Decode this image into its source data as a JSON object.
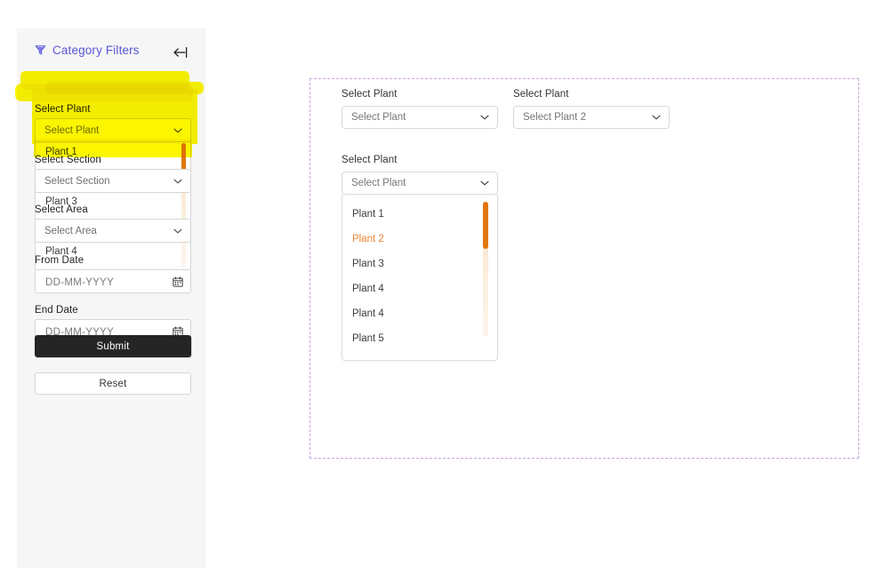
{
  "sidebar": {
    "title": "Category Filters",
    "filter_icon": "funnel-icon",
    "collapse_icon": "collapse-left-arrow-icon",
    "fields": [
      {
        "label": "Select Plant",
        "placeholder": "Select Plant",
        "type": "select"
      },
      {
        "label": "Select Section",
        "placeholder": "Select Section",
        "type": "select"
      },
      {
        "label": "Select Area",
        "placeholder": "Select Area",
        "type": "select"
      },
      {
        "label": "From Date",
        "placeholder": "DD-MM-YYYY",
        "value": "",
        "type": "date"
      },
      {
        "label": "End Date",
        "placeholder": "DD-MM-YYYY",
        "value": "",
        "type": "date"
      }
    ],
    "open_list_options": [
      "Plant 1",
      "Plant 3",
      "Plant 4"
    ],
    "buttons": {
      "submit": "Submit",
      "reset": "Reset"
    },
    "annotation": {
      "type": "yellow-marker-highlight",
      "color": "#fbf500",
      "target": "Select Plant field"
    }
  },
  "main": {
    "border_color": "#c9a6d3",
    "groups": [
      {
        "label": "Select Plant",
        "placeholder": "Select Plant",
        "open": false
      },
      {
        "label": "Select Plant",
        "placeholder": "Select Plant 2",
        "open": false
      },
      {
        "label": "Select Plant",
        "placeholder": "Select Plant",
        "open": true
      }
    ],
    "open_dropdown": {
      "options": [
        "Plant 1",
        "Plant 2",
        "Plant 3",
        "Plant 4",
        "Plant 4",
        "Plant 5"
      ],
      "selected": "Plant 2",
      "selected_color": "#ef8331",
      "scrollbar_thumb_color": "#e2760c",
      "scrollbar_track_color": "#f7e3cd"
    }
  },
  "colors": {
    "sidebar_bg": "#f6f6f6",
    "accent_purple": "#5a57d6",
    "submit_bg": "#252525",
    "orange": "#e2760c"
  }
}
